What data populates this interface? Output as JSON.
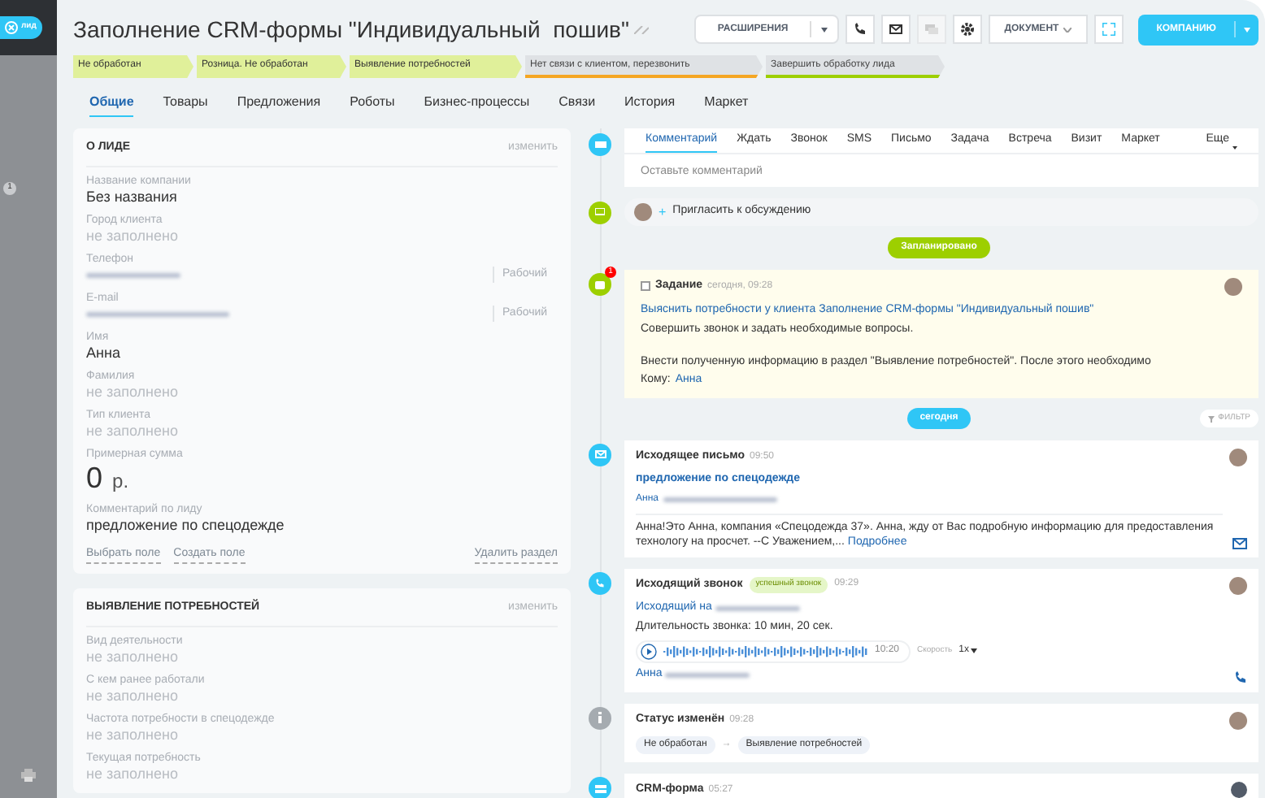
{
  "sidebar": {
    "close_label": "лид",
    "badge": "1"
  },
  "title": "Заполнение CRM-формы \"Индивидуальный  пошив\"",
  "toolbar": {
    "extensions": "РАСШИРЕНИЯ",
    "document": "ДОКУМЕНТ",
    "primary": "КОМПАНИЮ"
  },
  "stages": [
    {
      "label": "Не обработан",
      "kind": "done"
    },
    {
      "label": "Розница. Не обработан",
      "kind": "done"
    },
    {
      "label": "Выявление потребностей",
      "kind": "done"
    },
    {
      "label": "Нет связи с клиентом, перезвонить",
      "kind": "fail"
    },
    {
      "label": "Завершить обработку лида",
      "kind": "success"
    }
  ],
  "tabs": [
    {
      "label": "Общие",
      "selected": true
    },
    {
      "label": "Товары",
      "selected": false
    },
    {
      "label": "Предложения",
      "selected": false
    },
    {
      "label": "Роботы",
      "selected": false
    },
    {
      "label": "Бизнес-процессы",
      "selected": false
    },
    {
      "label": "Связи",
      "selected": false
    },
    {
      "label": "История",
      "selected": false
    },
    {
      "label": "Маркет",
      "selected": false
    }
  ],
  "lead_card": {
    "title": "О ЛИДЕ",
    "edit": "изменить",
    "fields": [
      {
        "label": "Название компании",
        "value": "Без названия",
        "kind": "value"
      },
      {
        "label": "Город клиента",
        "value": "не заполнено",
        "kind": "empty"
      },
      {
        "label": "Телефон",
        "type": "Рабочий",
        "kind": "blurred"
      },
      {
        "label": "E-mail",
        "type": "Рабочий",
        "kind": "blurred"
      },
      {
        "label": "Имя",
        "value": "Анна",
        "kind": "value"
      },
      {
        "label": "Фамилия",
        "value": "не заполнено",
        "kind": "empty"
      },
      {
        "label": "Тип клиента",
        "value": "не заполнено",
        "kind": "empty"
      },
      {
        "label": "Примерная сумма",
        "value": "0",
        "currency": "р.",
        "kind": "money"
      },
      {
        "label": "Комментарий по лиду",
        "value": "предложение по спецодежде",
        "kind": "value"
      }
    ],
    "links": [
      "Выбрать поле",
      "Создать поле"
    ],
    "delete": "Удалить раздел"
  },
  "needs_card": {
    "title": "ВЫЯВЛЕНИЕ ПОТРЕБНОСТЕЙ",
    "edit": "изменить",
    "fields": [
      {
        "label": "Вид деятельности",
        "value": "не заполнено",
        "kind": "empty"
      },
      {
        "label": "С кем ранее работали",
        "value": "не заполнено",
        "kind": "empty"
      },
      {
        "label": "Частота потребности в спецодежде",
        "value": "не заполнено",
        "kind": "empty"
      },
      {
        "label": "Текущая потребность",
        "value": "не заполнено",
        "kind": "empty"
      }
    ]
  },
  "composer": {
    "tabs": [
      {
        "label": "Комментарий",
        "selected": true
      },
      {
        "label": "Ждать",
        "selected": false
      },
      {
        "label": "Звонок",
        "selected": false
      },
      {
        "label": "SMS",
        "selected": false
      },
      {
        "label": "Письмо",
        "selected": false
      },
      {
        "label": "Задача",
        "selected": false
      },
      {
        "label": "Встреча",
        "selected": false
      },
      {
        "label": "Визит",
        "selected": false
      },
      {
        "label": "Маркет",
        "selected": false
      }
    ],
    "more": "Еще",
    "placeholder": "Оставьте комментарий"
  },
  "invite": "Пригласить к обсуждению",
  "invite_plus": "+",
  "planned_label": "Запланировано",
  "task": {
    "title": "Задание",
    "time": "сегодня, 09:28",
    "badge": "1",
    "checked": false,
    "link": "Выяснить потребности у клиента Заполнение CRM-формы \"Индивидуальный пошив\"",
    "line1": "Совершить звонок и задать необходимые вопросы.",
    "line2": "Внести полученную информацию в раздел \"Выявление потребностей\". После этого необходимо",
    "to_label": "Кому:",
    "to": "Анна"
  },
  "today_label": "сегодня",
  "filter": "ФИЛЬТР",
  "email": {
    "title": "Исходящее письмо",
    "time": "09:50",
    "subject": "предложение по спецодежде",
    "from": "Анна",
    "body": "Анна!Это Анна, компания «Спецодежда 37». Анна, жду от Вас подробную информацию для предоставления технологу на просчет. --С Уважением,...",
    "more": "Подробнее"
  },
  "call": {
    "title": "Исходящий звонок",
    "tag": "успешный звонок",
    "time": "09:29",
    "to": "Исходящий на",
    "duration": "Длительность звонка: 10 мин, 20 сек.",
    "length": "10:20",
    "speed_label": "Скорость",
    "speed": "1x",
    "person": "Анна"
  },
  "status": {
    "title": "Статус изменён",
    "time": "09:28",
    "from": "Не обработан",
    "arrow": "→",
    "to": "Выявление потребностей"
  },
  "form": {
    "title": "CRM-форма",
    "time": "05:27"
  }
}
